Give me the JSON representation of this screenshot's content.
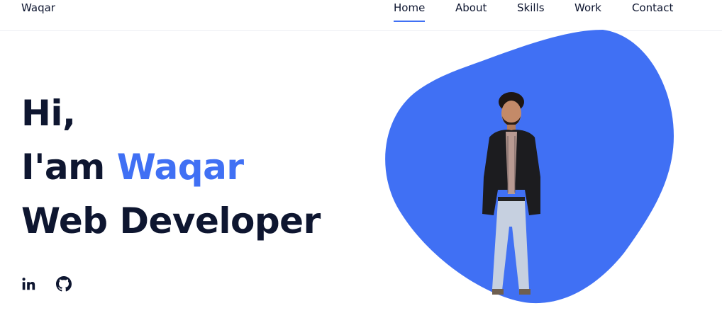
{
  "header": {
    "logo": "Waqar",
    "nav": [
      "Home",
      "About",
      "Skills",
      "Work",
      "Contact"
    ],
    "active_nav": "Home"
  },
  "hero": {
    "greeting": "Hi,",
    "intro_prefix": "I'am",
    "name": "Waqar",
    "role": "Web Developer"
  },
  "social": {
    "icons": [
      "linkedin-icon",
      "github-icon"
    ]
  },
  "colors": {
    "accent": "#4070f4",
    "text_dark": "#0e1630",
    "background": "#ffffff"
  }
}
